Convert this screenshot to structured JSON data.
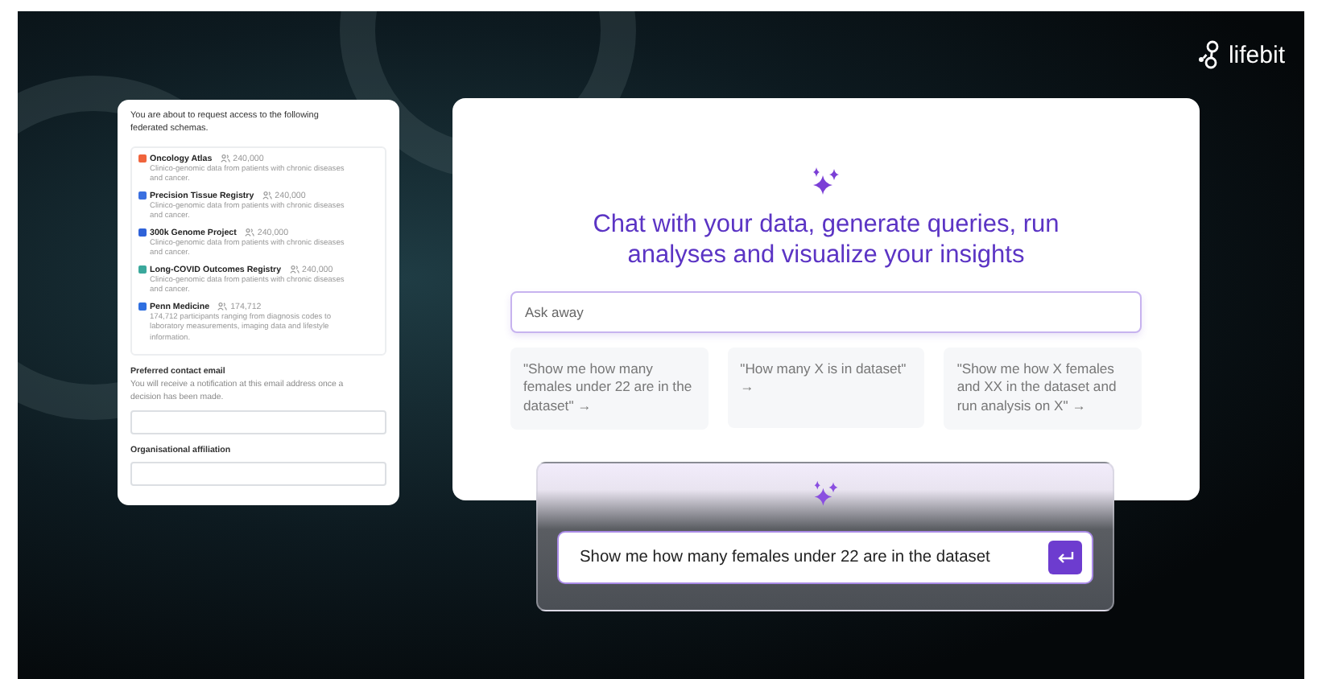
{
  "brand": {
    "name": "lifebit"
  },
  "request_panel": {
    "intro": "You are about to request access to the following federated schemas.",
    "schemas": [
      {
        "name": "Oncology Atlas",
        "count": "240,000",
        "description": "Clinico-genomic data from patients with chronic diseases and cancer.",
        "color": "#f0643c"
      },
      {
        "name": "Precision Tissue Registry",
        "count": "240,000",
        "description": "Clinico-genomic data from patients with chronic diseases and cancer.",
        "color": "#3a6fe0"
      },
      {
        "name": "300k Genome Project",
        "count": "240,000",
        "description": "Clinico-genomic data from patients with chronic diseases and cancer.",
        "color": "#2f62d8"
      },
      {
        "name": "Long-COVID Outcomes Registry",
        "count": "240,000",
        "description": "Clinico-genomic data from patients with chronic diseases and cancer.",
        "color": "#3aa89c"
      },
      {
        "name": "Penn Medicine",
        "count": "174,712",
        "description": "174,712 participants ranging from diagnosis codes to laboratory measurements, imaging data and lifestyle information.",
        "color": "#2f6fe0"
      }
    ],
    "fields": [
      {
        "label": "Preferred contact email",
        "help": "You will receive a notification at this email address once a decision has been made."
      },
      {
        "label": "Organisational affiliation"
      }
    ]
  },
  "chat_panel": {
    "heading": "Chat with your data, generate queries, run analyses and visualize your insights",
    "input": {
      "placeholder": "Ask away"
    },
    "suggestions": [
      {
        "text": "\"Show me how many females under 22 are in the dataset\"",
        "arrow": "→"
      },
      {
        "text": "\"How many X is in dataset\"",
        "arrow": "→"
      },
      {
        "text": "\"Show me how X females and XX in the dataset and run analysis on X\"",
        "arrow": "→"
      }
    ]
  },
  "prompt_box": {
    "value": "Show me how many females under 22 are in the dataset"
  }
}
